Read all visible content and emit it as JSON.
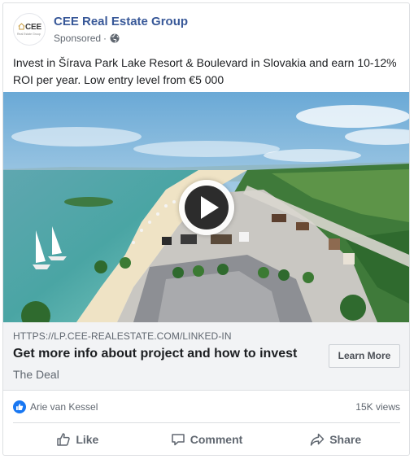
{
  "post": {
    "page_name": "CEE Real Estate Group",
    "avatar_logo_text": "CEE",
    "avatar_logo_subtext": "Real Estate Group",
    "sponsored_label": "Sponsored",
    "meta_separator": "·",
    "privacy_icon": "globe-icon",
    "text": "Invest in Šírava Park Lake Resort & Boulevard in Slovakia and earn 10-12% ROI per year. Low entry level from €5 000"
  },
  "media": {
    "play_icon": "play-icon"
  },
  "link": {
    "domain": "HTTPS://LP.CEE-REALESTATE.COM/LINKED-IN",
    "title": "Get more info about project and how to invest",
    "description": "The Deal",
    "cta_label": "Learn More"
  },
  "reactions": {
    "icon": "like-reaction-icon",
    "reactor": "Arie van Kessel",
    "views": "15K views"
  },
  "actions": {
    "like_label": "Like",
    "comment_label": "Comment",
    "share_label": "Share"
  },
  "colors": {
    "page_name": "#385898",
    "reaction_blue": "#1877f2",
    "link_bg": "#f2f3f5"
  }
}
